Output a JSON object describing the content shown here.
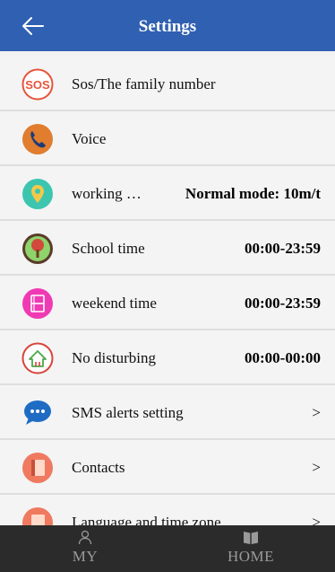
{
  "header": {
    "title": "Settings"
  },
  "rows": [
    {
      "label": "Sos/The family number",
      "value": "",
      "chevron": ""
    },
    {
      "label": "Voice",
      "value": "",
      "chevron": ""
    },
    {
      "label": "working …",
      "value": "Normal mode: 10m/t",
      "chevron": ""
    },
    {
      "label": "School time",
      "value": "00:00-23:59",
      "chevron": ""
    },
    {
      "label": "weekend time",
      "value": "00:00-23:59",
      "chevron": ""
    },
    {
      "label": "No disturbing",
      "value": "00:00-00:00",
      "chevron": ""
    },
    {
      "label": "SMS alerts setting",
      "value": "",
      "chevron": ">"
    },
    {
      "label": "Contacts",
      "value": "",
      "chevron": ">"
    },
    {
      "label": "Language and time zone",
      "value": "",
      "chevron": ">"
    }
  ],
  "icons": {
    "sos_text": "SOS",
    "sos_color": "#e8533a",
    "voice_color": "#e07d2e",
    "location_color": "#3cc6b0",
    "school_color": "#d24a3b",
    "weekend_color": "#f03ab4",
    "disturb_color": "#d8443a",
    "sms_color": "#1f6cc4",
    "contacts_color": "#ef7a60"
  },
  "tabbar": {
    "my_label": "MY",
    "home_label": "HOME"
  }
}
